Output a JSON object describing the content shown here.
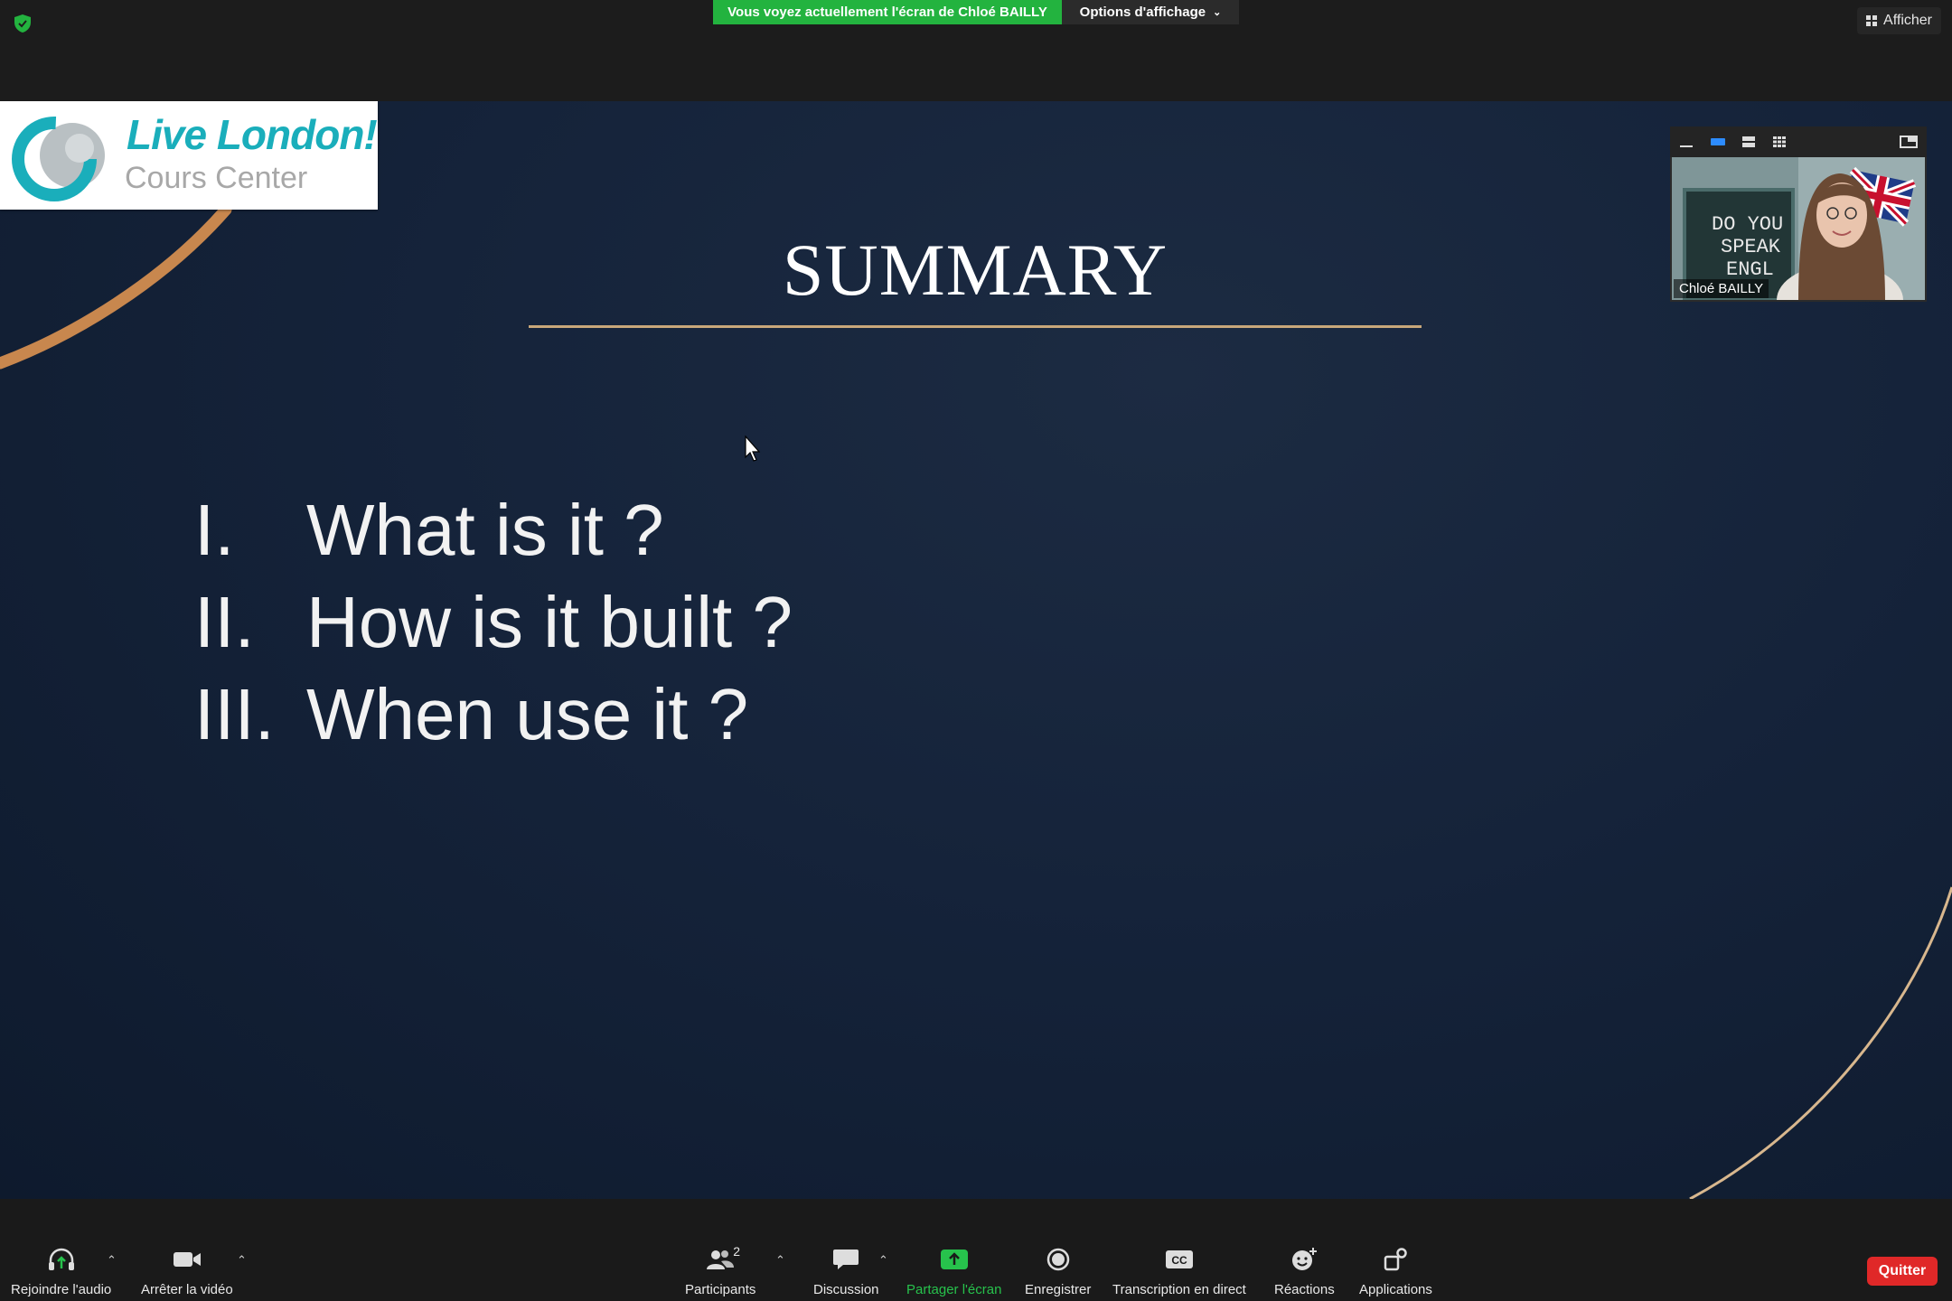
{
  "topbar": {
    "security_icon": "shield-check-icon",
    "sharing_banner": "Vous voyez actuellement l'écran de Chloé BAILLY",
    "view_options": "Options d'affichage",
    "show_button": "Afficher"
  },
  "slide": {
    "logo_line1": "Live London!",
    "logo_line2": "Cours Center",
    "title": "SUMMARY",
    "items": [
      {
        "num": "I.",
        "text": "What is it ?"
      },
      {
        "num": "II.",
        "text": "How is it built ?"
      },
      {
        "num": "III.",
        "text": "When use it ?"
      }
    ],
    "accent_color": "#c8a77a"
  },
  "video_tile": {
    "participant_name": "Chloé BAILLY",
    "board_text": [
      "DO YOU",
      "SPEAK",
      "ENGL"
    ]
  },
  "toolbar": {
    "audio": "Rejoindre l'audio",
    "video": "Arrêter la vidéo",
    "participants": "Participants",
    "participants_count": "2",
    "chat": "Discussion",
    "share": "Partager l'écran",
    "record": "Enregistrer",
    "captions": "Transcription en direct",
    "captions_badge": "CC",
    "reactions": "Réactions",
    "apps": "Applications",
    "quit": "Quitter"
  },
  "colors": {
    "banner_green": "#23b33f",
    "share_green": "#27c24c",
    "quit_red": "#e02828"
  }
}
